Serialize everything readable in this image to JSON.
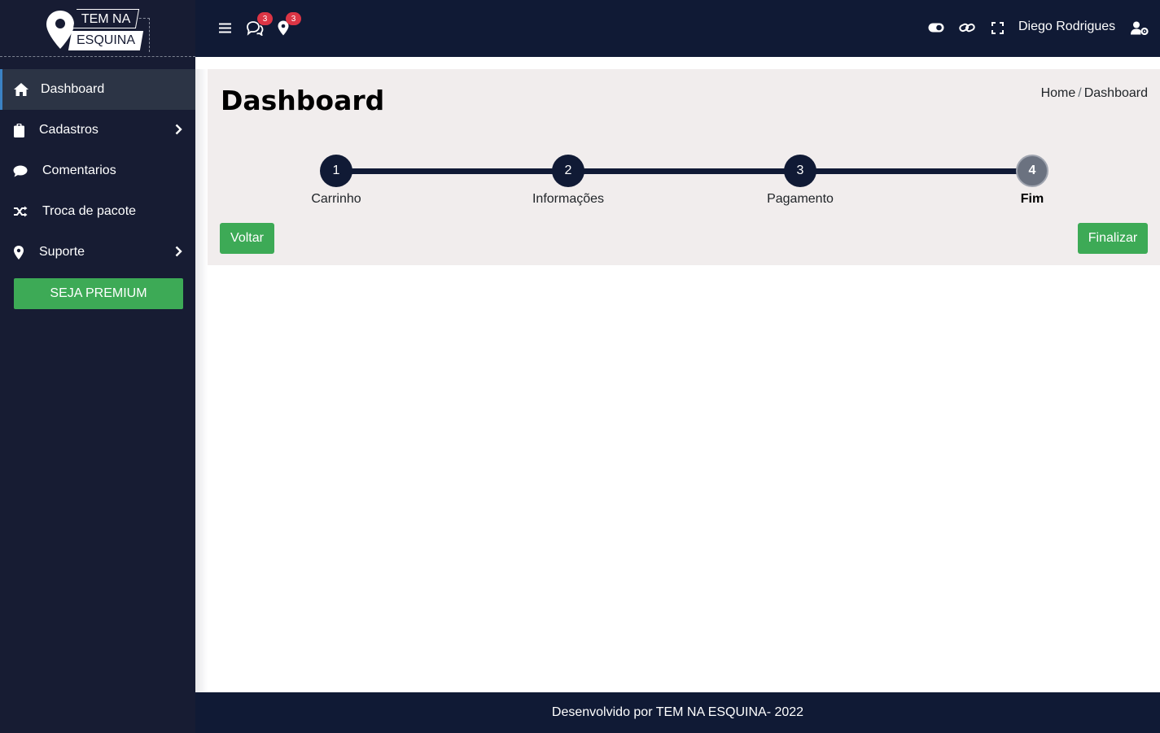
{
  "brand": {
    "logo_line1": "TEM NA",
    "logo_line2": "ESQUINA"
  },
  "sidebar": {
    "items": [
      {
        "label": "Dashboard",
        "icon": "home-icon",
        "active": true
      },
      {
        "label": "Cadastros",
        "icon": "clipboard-icon",
        "has_submenu": true
      },
      {
        "label": "Comentarios",
        "icon": "comment-icon"
      },
      {
        "label": "Troca de pacote",
        "icon": "shuffle-icon"
      },
      {
        "label": "Suporte",
        "icon": "map-marker-icon",
        "has_submenu": true
      }
    ],
    "premium_label": "SEJA PREMIUM"
  },
  "topbar": {
    "menu_icon": "hamburger-icon",
    "comments_badge": "3",
    "location_badge": "3",
    "user_name": "Diego Rodrigues",
    "icons": [
      "toggle-icon",
      "link-icon",
      "fullscreen-icon",
      "user-cog-icon"
    ]
  },
  "main": {
    "title": "Dashboard",
    "breadcrumb": {
      "home": "Home",
      "separator": "/",
      "current": "Dashboard"
    },
    "steps": [
      {
        "number": "1",
        "label": "Carrinho"
      },
      {
        "number": "2",
        "label": "Informações"
      },
      {
        "number": "3",
        "label": "Pagamento"
      },
      {
        "number": "4",
        "label": "Fim",
        "current": true
      }
    ],
    "back_label": "Voltar",
    "finish_label": "Finalizar"
  },
  "footer": {
    "text": "Desenvolvido por TEM NA ESQUINA- 2022"
  },
  "colors": {
    "sidebar_bg": "#171c33",
    "topbar_bg": "#101a35",
    "accent_green": "#3daa56",
    "badge_red": "#dc3545",
    "panel_bg": "#f1eded"
  }
}
